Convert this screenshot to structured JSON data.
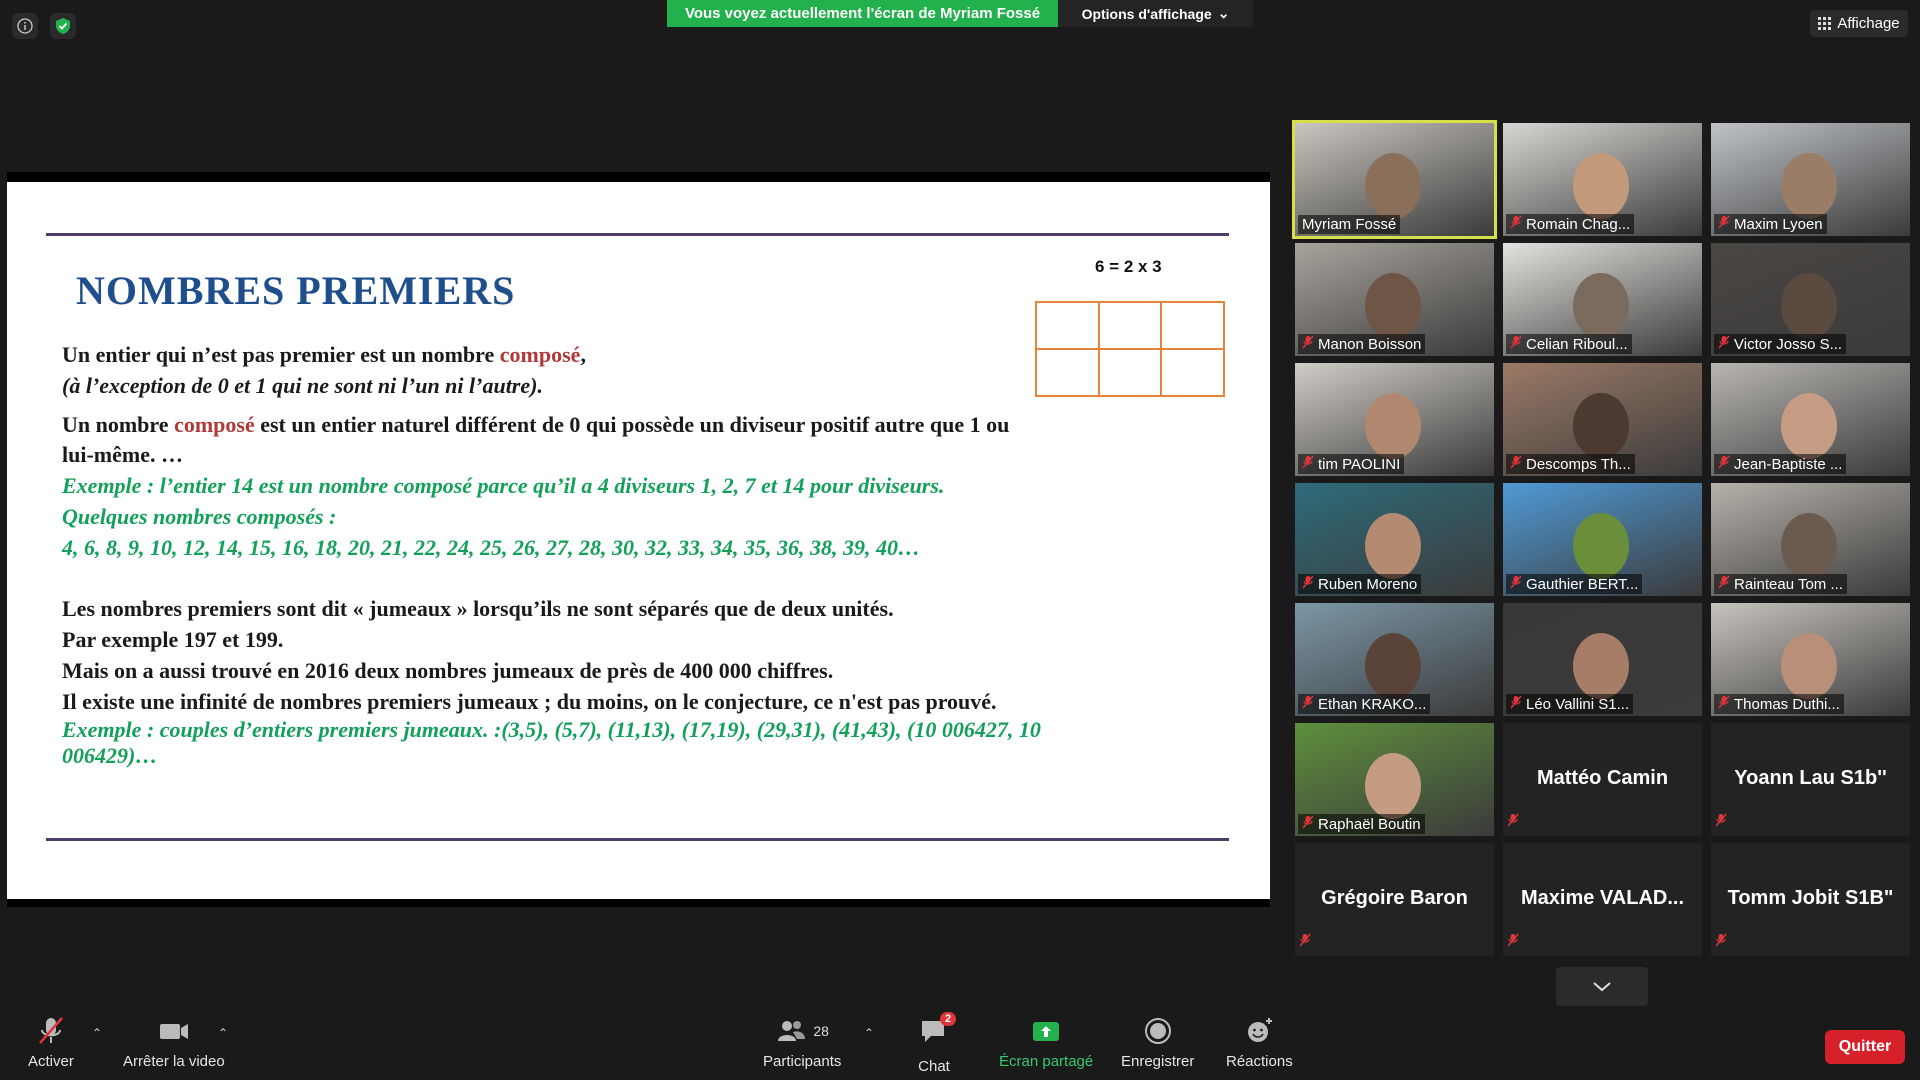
{
  "top_bar": {
    "share_banner": "Vous voyez actuellement l'écran de Myriam Fossé",
    "view_options": "Options d'affichage",
    "affichage": "Affichage"
  },
  "slide": {
    "title": "NOMBRES PREMIERS",
    "equation": "6 = 2 x 3",
    "p1_pre": "Un entier qui n’est pas premier est un nombre ",
    "p1_word": "composé",
    "p1_post": ",",
    "p2": "(à l’exception de 0 et 1 qui ne sont ni l’un ni l’autre).",
    "p3_pre": "Un nombre ",
    "p3_word": "composé",
    "p3_post": " est un entier naturel différent de 0 qui possède un diviseur positif autre que 1 ou",
    "p4": "lui-même. …",
    "p5": "Exemple : l’entier 14 est un nombre composé parce qu’il a 4 diviseurs 1, 2, 7 et 14 pour diviseurs.",
    "p6": "Quelques nombres composés :",
    "p7": "4, 6, 8, 9, 10, 12, 14, 15, 16, 18, 20, 21, 22, 24, 25, 26, 27, 28, 30, 32, 33, 34, 35, 36, 38, 39, 40…",
    "p8": "Les nombres premiers sont dit « jumeaux » lorsqu’ils ne sont séparés que de deux unités.",
    "p9": "Par exemple 197 et 199.",
    "p10": "Mais on a aussi trouvé en 2016 deux nombres jumeaux de près de 400 000 chiffres.",
    "p11": "Il existe une infinité de nombres premiers jumeaux ; du moins, on le conjecture, ce n'est pas prouvé.",
    "p12": "Exemple : couples d’entiers premiers jumeaux. :(3,5), (5,7), (11,13), (17,19), (29,31), (41,43), (10 006427, 10",
    "p13": "006429)…"
  },
  "participants": [
    {
      "name": "Myriam Fossé",
      "video": true,
      "muted": false,
      "active": true
    },
    {
      "name": "Romain Chag...",
      "video": true,
      "muted": true
    },
    {
      "name": "Maxim Lyoen",
      "video": true,
      "muted": true
    },
    {
      "name": "Manon Boisson",
      "video": true,
      "muted": true
    },
    {
      "name": "Celian Riboul...",
      "video": true,
      "muted": true
    },
    {
      "name": "Victor Josso S...",
      "video": true,
      "muted": true
    },
    {
      "name": "tim PAOLINI",
      "video": true,
      "muted": true
    },
    {
      "name": "Descomps Th...",
      "video": true,
      "muted": true
    },
    {
      "name": "Jean-Baptiste ...",
      "video": true,
      "muted": true
    },
    {
      "name": "Ruben Moreno",
      "video": true,
      "muted": true
    },
    {
      "name": "Gauthier BERT...",
      "video": true,
      "muted": true
    },
    {
      "name": "Rainteau Tom ...",
      "video": true,
      "muted": true
    },
    {
      "name": "Ethan KRAKO...",
      "video": true,
      "muted": true
    },
    {
      "name": "Léo Vallini S1...",
      "video": true,
      "muted": true
    },
    {
      "name": "Thomas Duthi...",
      "video": true,
      "muted": true
    },
    {
      "name": "Raphaël Boutin",
      "video": true,
      "muted": true
    },
    {
      "name": "Mattéo Camin",
      "video": false,
      "muted": true
    },
    {
      "name": "Yoann Lau S1b''",
      "video": false,
      "muted": true
    },
    {
      "name": "Grégoire Baron",
      "video": false,
      "muted": true
    },
    {
      "name": "Maxime  VALAD...",
      "video": false,
      "muted": true
    },
    {
      "name": "Tomm Jobit S1B\"",
      "video": false,
      "muted": true
    }
  ],
  "toolbar": {
    "mute_label": "Activer",
    "video_label": "Arrêter la video",
    "participants_label": "Participants",
    "participants_count": "28",
    "chat_label": "Chat",
    "chat_badge": "2",
    "share_label": "Écran partagé",
    "record_label": "Enregistrer",
    "reactions_label": "Réactions",
    "quit_label": "Quitter"
  },
  "colors": {
    "share_green": "#23b14d",
    "slide_title": "#1f4e8c",
    "highlight_red": "#b03a3a",
    "example_green": "#13a05a",
    "quit_red": "#d6202a"
  }
}
